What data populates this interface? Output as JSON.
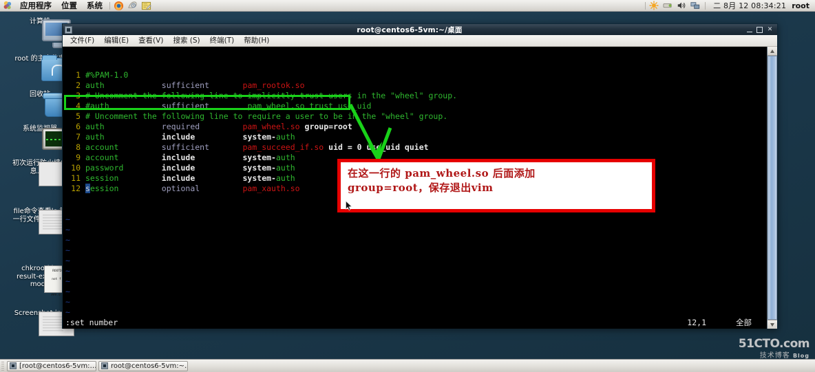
{
  "top_panel": {
    "menus": [
      "应用程序",
      "位置",
      "系统"
    ],
    "icons": [
      "gnome-foot-icon",
      "firefox-icon",
      "help-clock-icon",
      "text-editor-icon"
    ],
    "tray_icons": [
      "brightness-icon",
      "keyboard-icon",
      "volume-icon",
      "network-icon"
    ],
    "clock": "二 8月 12 08:34:21",
    "user": "root"
  },
  "desktop_icons": [
    {
      "name": "computer",
      "glyph": "monitor-icon",
      "label": "计算机"
    },
    {
      "name": "home-folder",
      "glyph": "home-folder-icon",
      "label": "root 的主文件夹"
    },
    {
      "name": "trash",
      "glyph": "trash-icon",
      "label": "回收站"
    },
    {
      "name": "system-monitor",
      "glyph": "system-monitor-icon",
      "label": "系统监视器"
    },
    {
      "name": "firewall-screenshot",
      "glyph": "image-thumb-icon",
      "label": "初次运行防火墙信息.jpg"
    },
    {
      "name": "file-command-screenshot",
      "glyph": "image-thumb-dark-icon",
      "label": "file命令查看ls-第一行文件类型.jpg"
    },
    {
      "name": "chkrootkit-result",
      "glyph": "text-file-icon",
      "label": "chkrootkit-result-expert-mode"
    },
    {
      "name": "screenshot",
      "glyph": "image-thumb-dark-icon",
      "label": "Screenshot.jpg"
    }
  ],
  "terminal": {
    "title": "root@centos6-5vm:~/桌面",
    "window_buttons": [
      "minimize-icon",
      "maximize-icon",
      "close-icon"
    ],
    "menus": [
      "文件(F)",
      "编辑(E)",
      "查看(V)",
      "搜索 (S)",
      "终端(T)",
      "帮助(H)"
    ],
    "lines": [
      {
        "num": "1",
        "parts": [
          {
            "t": "#%PAM-1.0",
            "c": "c-green"
          }
        ]
      },
      {
        "num": "2",
        "parts": [
          {
            "t": "auth",
            "c": "c-green"
          },
          {
            "t": "            ",
            "c": ""
          },
          {
            "t": "sufficient",
            "c": "c-grey"
          },
          {
            "t": "       ",
            "c": ""
          },
          {
            "t": "pam_rootok.so",
            "c": "c-red"
          }
        ]
      },
      {
        "num": "3",
        "parts": [
          {
            "t": "# Uncomment the following line to implicitly trust users in the \"wheel\" group.",
            "c": "c-green"
          }
        ]
      },
      {
        "num": "4",
        "parts": [
          {
            "t": "#auth",
            "c": "c-green"
          },
          {
            "t": "           ",
            "c": ""
          },
          {
            "t": "sufficient",
            "c": "c-grey"
          },
          {
            "t": "        ",
            "c": ""
          },
          {
            "t": "pam_wheel.so trust use_uid",
            "c": "c-green"
          }
        ]
      },
      {
        "num": "5",
        "parts": [
          {
            "t": "# Uncomment the following line to require a user to be in the \"wheel\" group.",
            "c": "c-green"
          }
        ]
      },
      {
        "num": "6",
        "parts": [
          {
            "t": "auth",
            "c": "c-green"
          },
          {
            "t": "            ",
            "c": ""
          },
          {
            "t": "required",
            "c": "c-grey"
          },
          {
            "t": "         ",
            "c": ""
          },
          {
            "t": "pam_wheel.so",
            "c": "c-red"
          },
          {
            "t": " ",
            "c": ""
          },
          {
            "t": "group=root",
            "c": "c-white"
          }
        ]
      },
      {
        "num": "7",
        "parts": [
          {
            "t": "auth",
            "c": "c-green"
          },
          {
            "t": "            ",
            "c": ""
          },
          {
            "t": "include",
            "c": "c-white"
          },
          {
            "t": "          ",
            "c": ""
          },
          {
            "t": "system-",
            "c": "c-white"
          },
          {
            "t": "auth",
            "c": "c-green"
          }
        ]
      },
      {
        "num": "8",
        "parts": [
          {
            "t": "account",
            "c": "c-green"
          },
          {
            "t": "         ",
            "c": ""
          },
          {
            "t": "sufficient",
            "c": "c-grey"
          },
          {
            "t": "       ",
            "c": ""
          },
          {
            "t": "pam_succeed_if.so",
            "c": "c-red"
          },
          {
            "t": " ",
            "c": ""
          },
          {
            "t": "uid = 0 use_uid quiet",
            "c": "c-white"
          }
        ]
      },
      {
        "num": "9",
        "parts": [
          {
            "t": "account",
            "c": "c-green"
          },
          {
            "t": "         ",
            "c": ""
          },
          {
            "t": "include",
            "c": "c-white"
          },
          {
            "t": "          ",
            "c": ""
          },
          {
            "t": "system-",
            "c": "c-white"
          },
          {
            "t": "auth",
            "c": "c-green"
          }
        ]
      },
      {
        "num": "10",
        "parts": [
          {
            "t": "password",
            "c": "c-green"
          },
          {
            "t": "        ",
            "c": ""
          },
          {
            "t": "include",
            "c": "c-white"
          },
          {
            "t": "          ",
            "c": ""
          },
          {
            "t": "system-",
            "c": "c-white"
          },
          {
            "t": "auth",
            "c": "c-green"
          }
        ]
      },
      {
        "num": "11",
        "parts": [
          {
            "t": "session",
            "c": "c-green"
          },
          {
            "t": "         ",
            "c": ""
          },
          {
            "t": "include",
            "c": "c-white"
          },
          {
            "t": "          ",
            "c": ""
          },
          {
            "t": "system-",
            "c": "c-white"
          },
          {
            "t": "auth",
            "c": "c-green"
          }
        ]
      },
      {
        "num": "12",
        "parts": [
          {
            "t": "s",
            "c": "cursor-blk"
          },
          {
            "t": "ession",
            "c": "c-green"
          },
          {
            "t": "         ",
            "c": ""
          },
          {
            "t": "optional",
            "c": "c-grey"
          },
          {
            "t": "         ",
            "c": ""
          },
          {
            "t": "pam_xauth.so",
            "c": "c-red"
          }
        ]
      }
    ],
    "empty_marker": "~",
    "empty_line_count": 14,
    "status": {
      "command": ":set number",
      "position": "12,1",
      "scroll": "全部"
    }
  },
  "annotations": {
    "green_box_target": "line 6 highlight",
    "green_arrow": "arrow-pointing-to-note",
    "note_text": "在这一行的 pam_wheel.so 后面添加\ngroup=root，保存退出vim",
    "colors": {
      "highlight": "#19d219",
      "note_border": "#e60000",
      "note_text": "#b01717"
    }
  },
  "watermark": {
    "line1": "51CTO.com",
    "line2": "技术博客",
    "line3": "Blog"
  },
  "bottom_panel": {
    "tasks": [
      {
        "icon": "terminal-icon",
        "label": "[root@centos6-5vm:…"
      },
      {
        "icon": "terminal-icon",
        "label": "root@centos6-5vm:~…"
      }
    ]
  }
}
